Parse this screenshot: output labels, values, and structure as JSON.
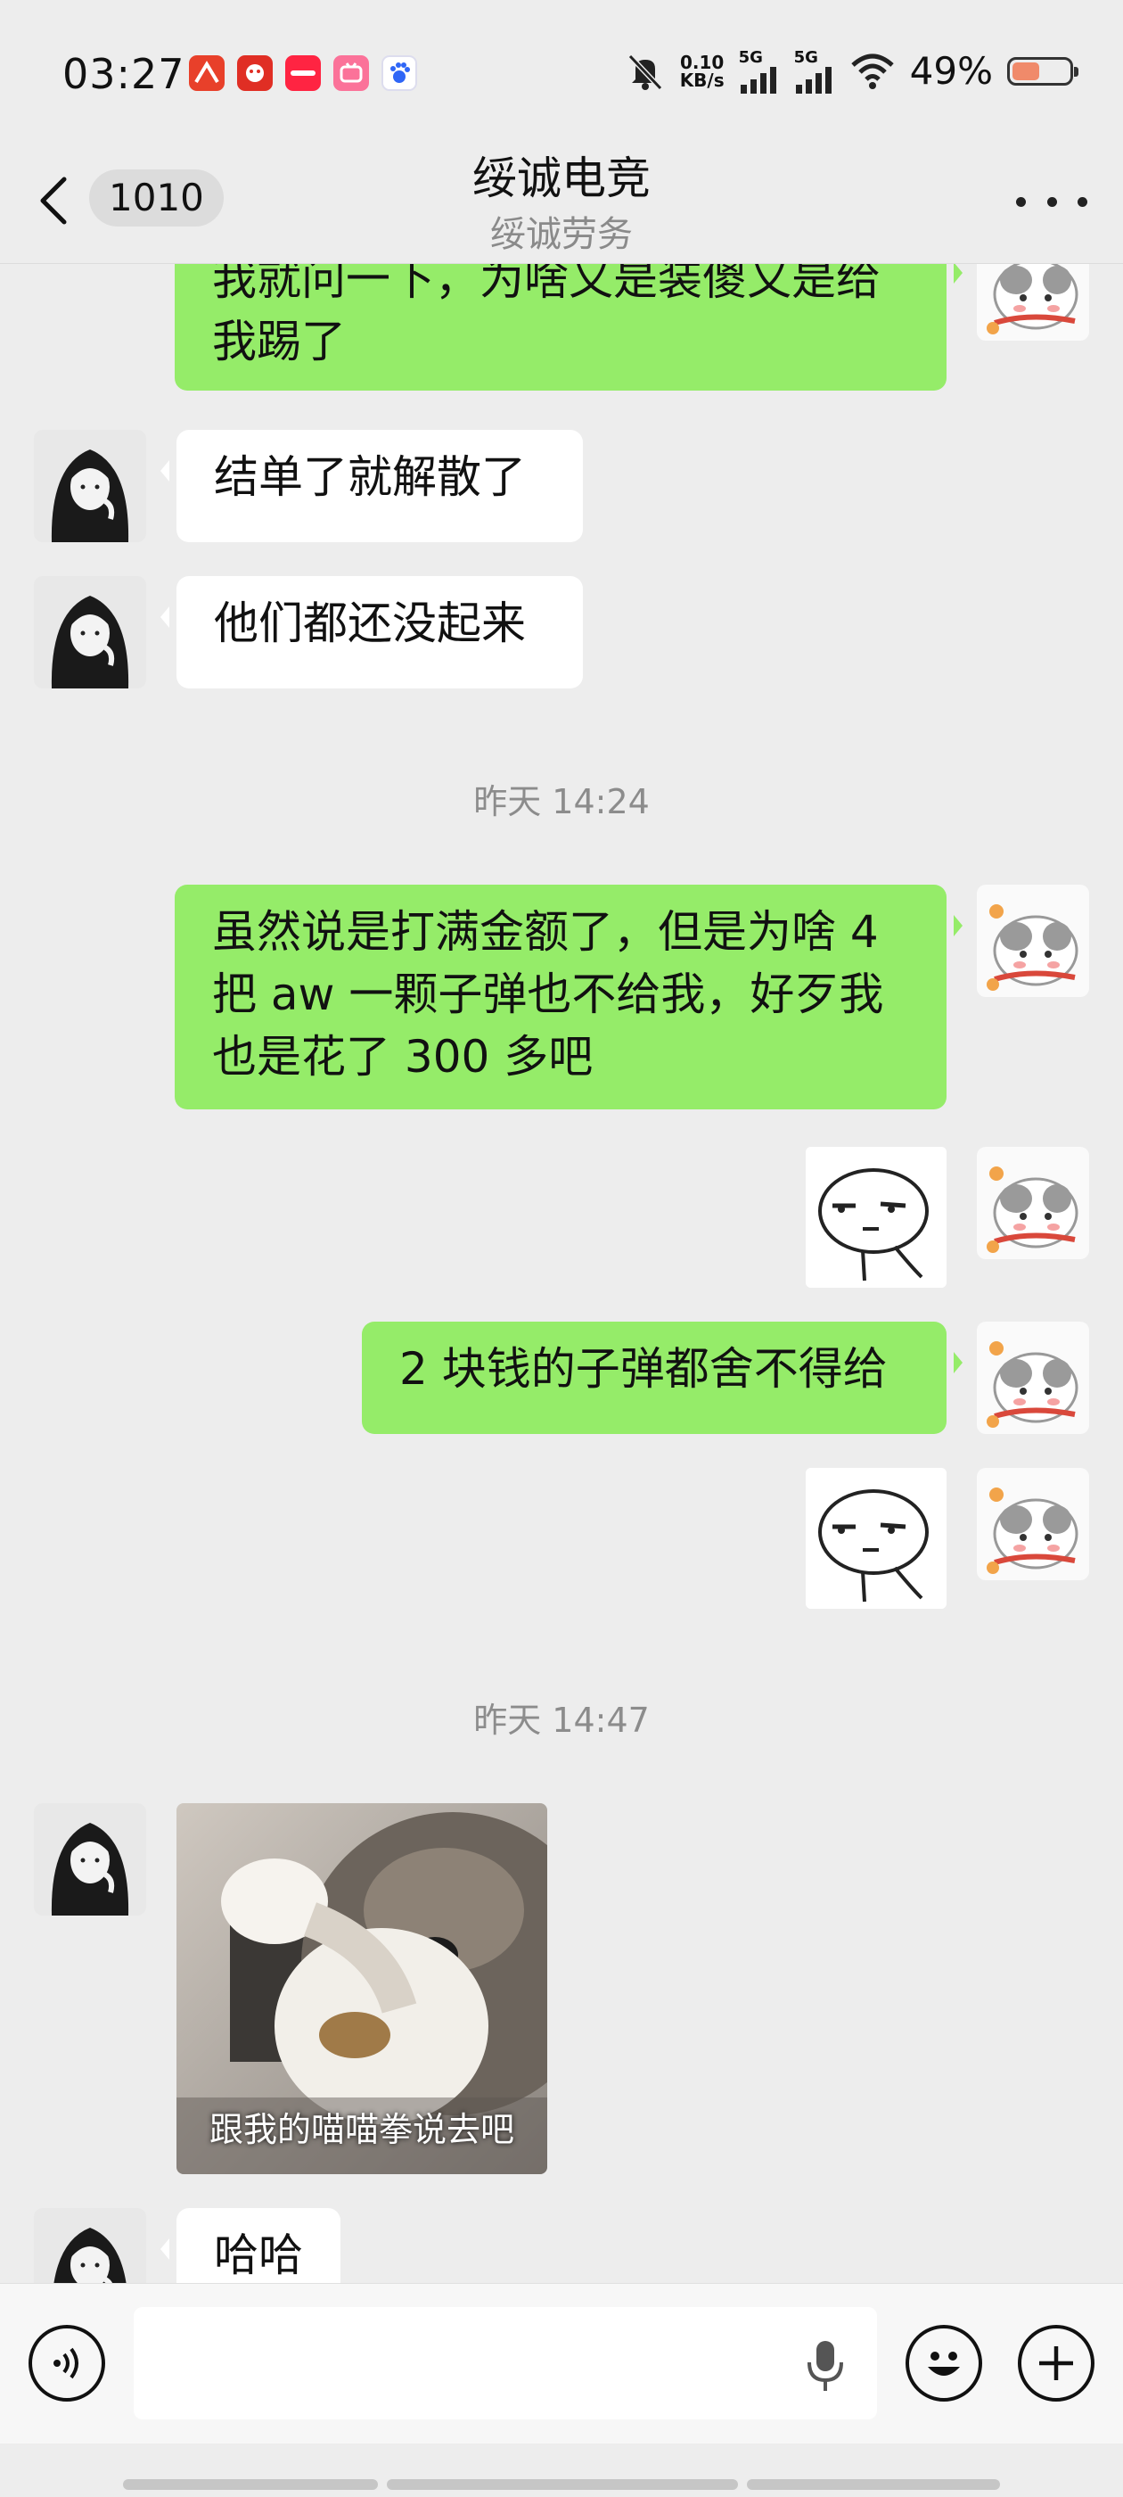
{
  "status_bar": {
    "time": "03:27",
    "net_speed_value": "0.10",
    "net_speed_unit": "KB/s",
    "signal1_label": "5G",
    "signal2_label": "5G",
    "battery": "49%",
    "battery_level": 0.49,
    "app_icons": [
      "学习通",
      "拼多多",
      "小红书",
      "哔哩哔哩",
      "百度"
    ]
  },
  "header": {
    "unread_count": "1010",
    "title": "绥诚电竞",
    "subtitle": "绥诚劳务"
  },
  "messages": {
    "m1": "我就问一下，为啥又是装傻又是给我踢了",
    "m2": "结单了就解散了",
    "m3": "他们都还没起来",
    "ts1": "昨天 14:24",
    "m4": "虽然说是打满金额了，但是为啥 4 把 aw 一颗子弹也不给我，好歹我也是花了 300 多吧",
    "m5": "2 块钱的子弹都舍不得给",
    "ts2": "昨天 14:47",
    "image_caption": "跟我的喵喵拳说去吧",
    "m6": "哈哈"
  },
  "colors": {
    "my_bubble": "#95ec69",
    "their_bubble": "#ffffff",
    "background": "#ededed"
  }
}
